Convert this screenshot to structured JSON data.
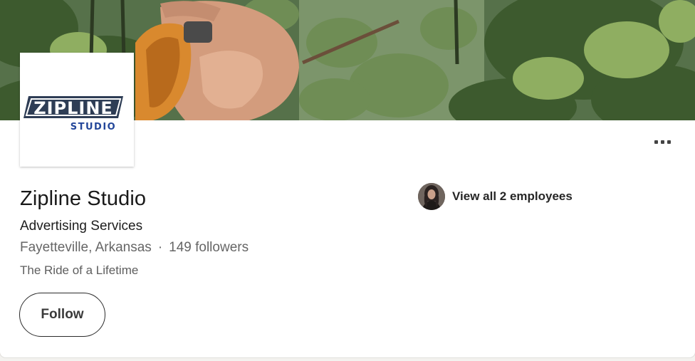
{
  "company": {
    "name": "Zipline Studio",
    "industry": "Advertising Services",
    "location": "Fayetteville, Arkansas",
    "separator": "·",
    "followers": "149 followers",
    "tagline": "The Ride of a Lifetime",
    "logo": {
      "line1": "ZIPLINE",
      "line2": "STUDIO"
    }
  },
  "actions": {
    "follow_label": "Follow",
    "more_icon": "more-horizontal-icon"
  },
  "employees": {
    "label": "View all 2 employees"
  },
  "colors": {
    "logo_blue": "#24479a",
    "logo_dark": "#2e3d55",
    "text_primary": "#191919",
    "text_secondary": "#666666"
  }
}
